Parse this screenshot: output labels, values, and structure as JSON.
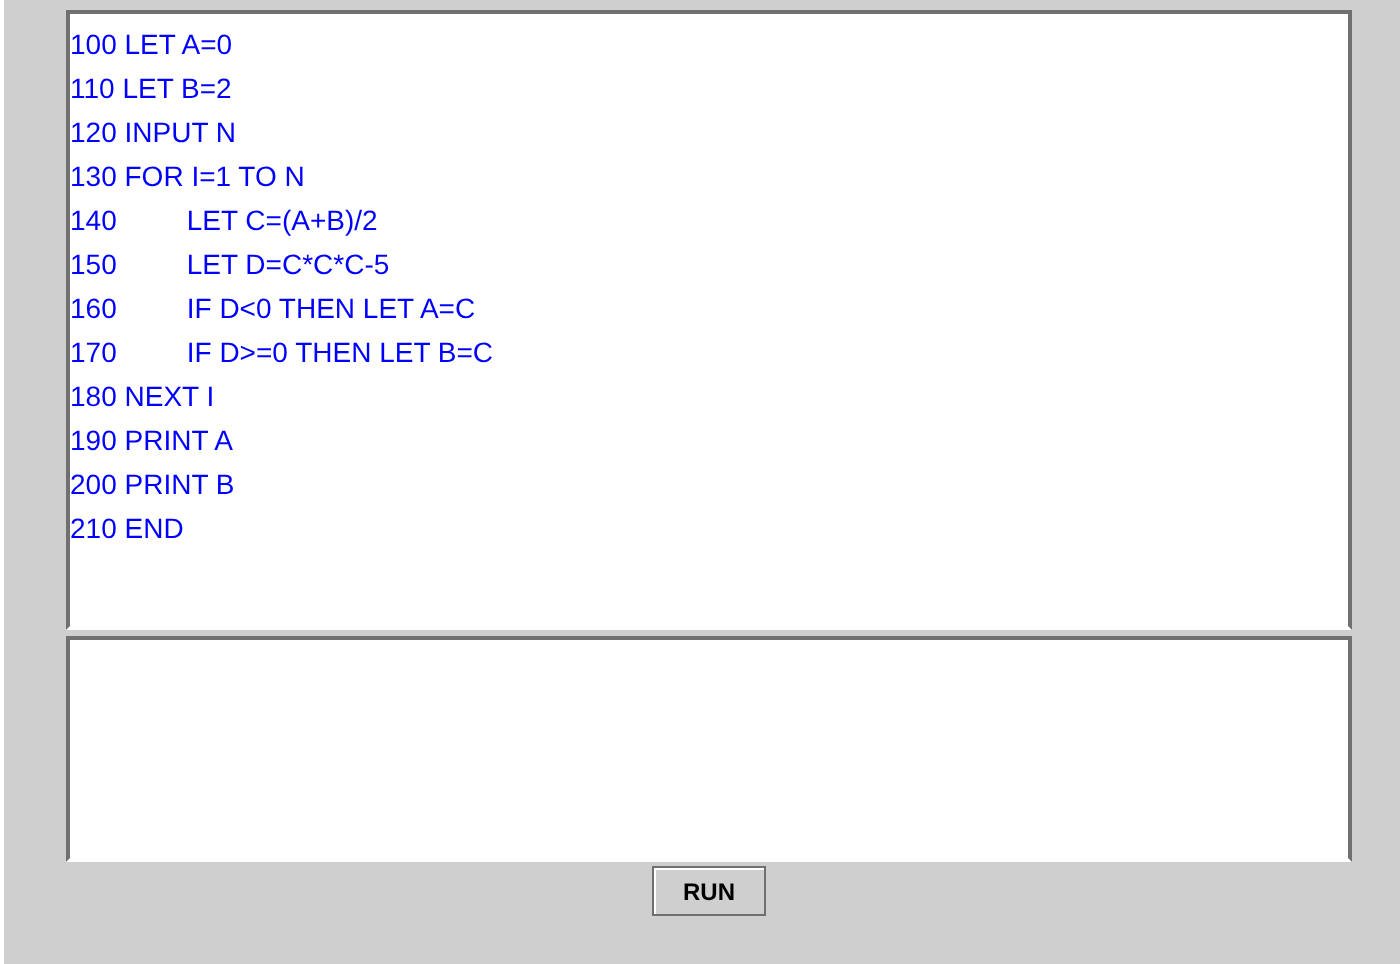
{
  "code_editor": {
    "lines": [
      "100 LET A=0",
      "110 LET B=2",
      "120 INPUT N",
      "130 FOR I=1 TO N",
      "140         LET C=(A+B)/2",
      "150         LET D=C*C*C-5",
      "160         IF D<0 THEN LET A=C",
      "170         IF D>=0 THEN LET B=C",
      "180 NEXT I",
      "190 PRINT A",
      "200 PRINT B",
      "210 END"
    ]
  },
  "buttons": [
    {
      "label": "RUN"
    }
  ]
}
